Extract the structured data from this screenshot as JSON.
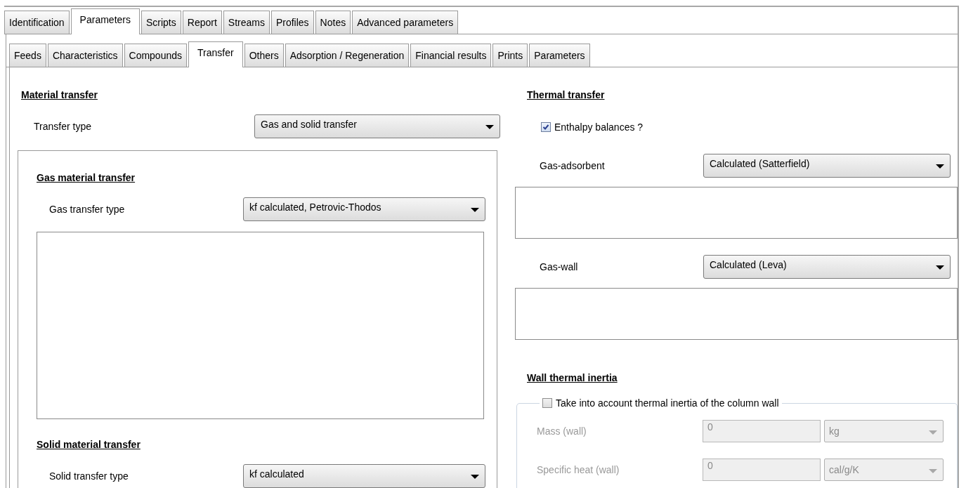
{
  "main_tabs": [
    {
      "label": "Identification",
      "selected": false
    },
    {
      "label": "Parameters",
      "selected": true
    },
    {
      "label": "Scripts",
      "selected": false
    },
    {
      "label": "Report",
      "selected": false
    },
    {
      "label": "Streams",
      "selected": false
    },
    {
      "label": "Profiles",
      "selected": false
    },
    {
      "label": "Notes",
      "selected": false
    },
    {
      "label": "Advanced parameters",
      "selected": false
    }
  ],
  "sub_tabs": [
    {
      "label": "Feeds",
      "selected": false
    },
    {
      "label": "Characteristics",
      "selected": false
    },
    {
      "label": "Compounds",
      "selected": false
    },
    {
      "label": "Transfer",
      "selected": true
    },
    {
      "label": "Others",
      "selected": false
    },
    {
      "label": "Adsorption / Regeneration",
      "selected": false
    },
    {
      "label": "Financial results",
      "selected": false
    },
    {
      "label": "Prints",
      "selected": false
    },
    {
      "label": "Parameters",
      "selected": false
    }
  ],
  "material_transfer": {
    "heading": "Material transfer",
    "transfer_type": {
      "label": "Transfer type",
      "value": "Gas and solid transfer"
    },
    "gas": {
      "heading": "Gas material transfer",
      "transfer_type": {
        "label": "Gas transfer type",
        "value": "kf calculated, Petrovic-Thodos"
      }
    },
    "solid": {
      "heading": "Solid material transfer",
      "transfer_type": {
        "label": "Solid transfer type",
        "value": "kf calculated"
      }
    }
  },
  "thermal_transfer": {
    "heading": "Thermal transfer",
    "enthalpy_balances": {
      "label": "Enthalpy balances ?",
      "checked": true
    },
    "gas_adsorbent": {
      "label": "Gas-adsorbent",
      "value": "Calculated (Satterfield)"
    },
    "gas_wall": {
      "label": "Gas-wall",
      "value": "Calculated (Leva)"
    }
  },
  "wall_thermal_inertia": {
    "heading": "Wall thermal inertia",
    "take_into_account": {
      "label": "Take into account thermal inertia of the column wall",
      "checked": false
    },
    "rows": [
      {
        "label": "Mass (wall)",
        "value": "0",
        "unit": "kg",
        "disabled": true
      },
      {
        "label": "Specific heat (wall)",
        "value": "0",
        "unit": "cal/g/K",
        "disabled": true
      }
    ]
  }
}
